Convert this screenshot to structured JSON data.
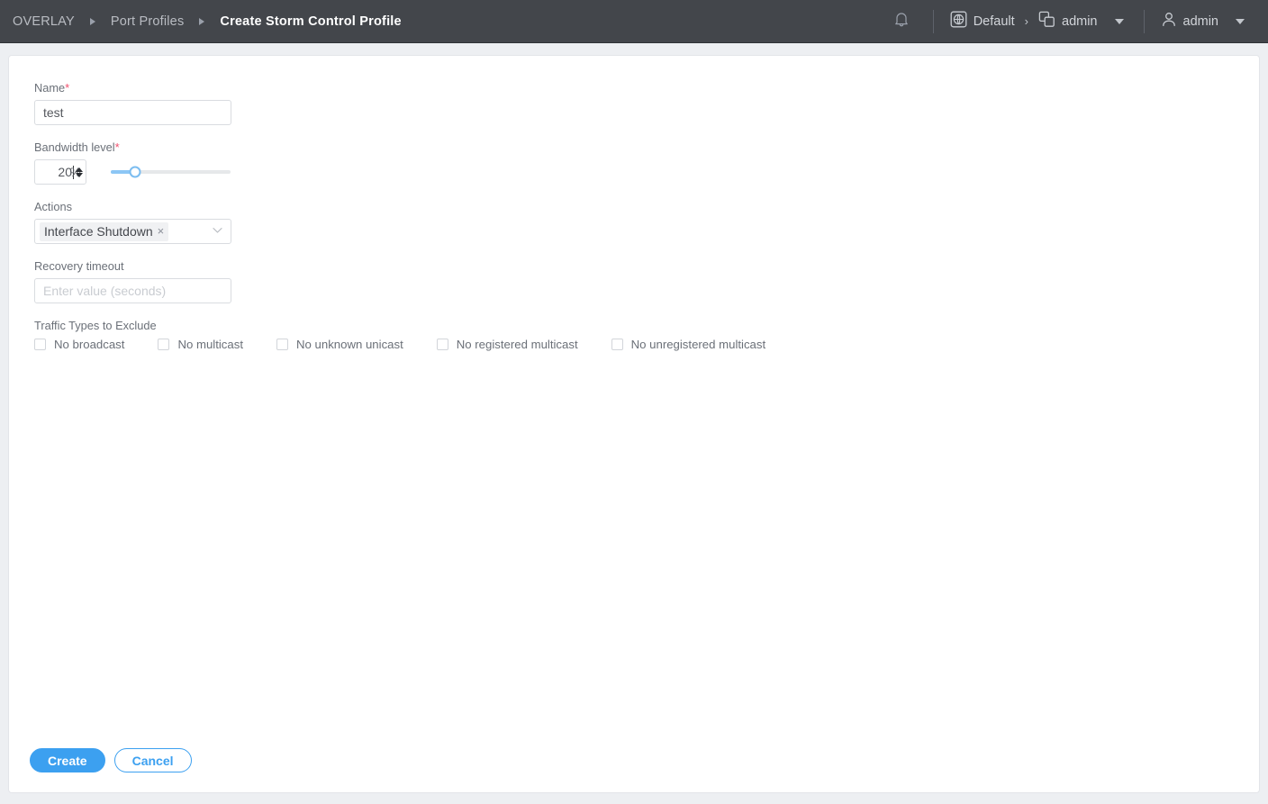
{
  "header": {
    "breadcrumb": [
      {
        "label": "OVERLAY",
        "active": false
      },
      {
        "label": "Port Profiles",
        "active": false
      },
      {
        "label": "Create Storm Control Profile",
        "active": true
      }
    ],
    "notifications_icon": "bell-icon",
    "org": {
      "icon": "globe-icon",
      "label": "Default"
    },
    "tenant": {
      "icon": "layers-icon",
      "label": "admin"
    },
    "user": {
      "icon": "user-icon",
      "label": "admin"
    },
    "separator": "›"
  },
  "form": {
    "name": {
      "label": "Name",
      "required_marker": "*",
      "value": "test",
      "placeholder": ""
    },
    "bandwidth": {
      "label": "Bandwidth level",
      "required_marker": "*",
      "value": "20",
      "unit": "%",
      "slider_percent": 20,
      "min": 0,
      "max": 100
    },
    "actions": {
      "label": "Actions",
      "tags": [
        {
          "label": "Interface Shutdown",
          "remove": "×"
        }
      ],
      "chevron": "⌄"
    },
    "recovery_timeout": {
      "label": "Recovery timeout",
      "value": "",
      "placeholder": "Enter value (seconds)"
    },
    "traffic_types": {
      "label": "Traffic Types to Exclude",
      "options": [
        {
          "label": "No broadcast",
          "checked": false
        },
        {
          "label": "No multicast",
          "checked": false
        },
        {
          "label": "No unknown unicast",
          "checked": false
        },
        {
          "label": "No registered multicast",
          "checked": false
        },
        {
          "label": "No unregistered multicast",
          "checked": false
        }
      ]
    }
  },
  "footer": {
    "create_label": "Create",
    "cancel_label": "Cancel"
  },
  "colors": {
    "header_bg": "#43464b",
    "page_bg": "#edeff2",
    "panel_bg": "#ffffff",
    "accent": "#3ca0f0",
    "required": "#f0506e",
    "slider_fill": "#8cc6f5"
  }
}
